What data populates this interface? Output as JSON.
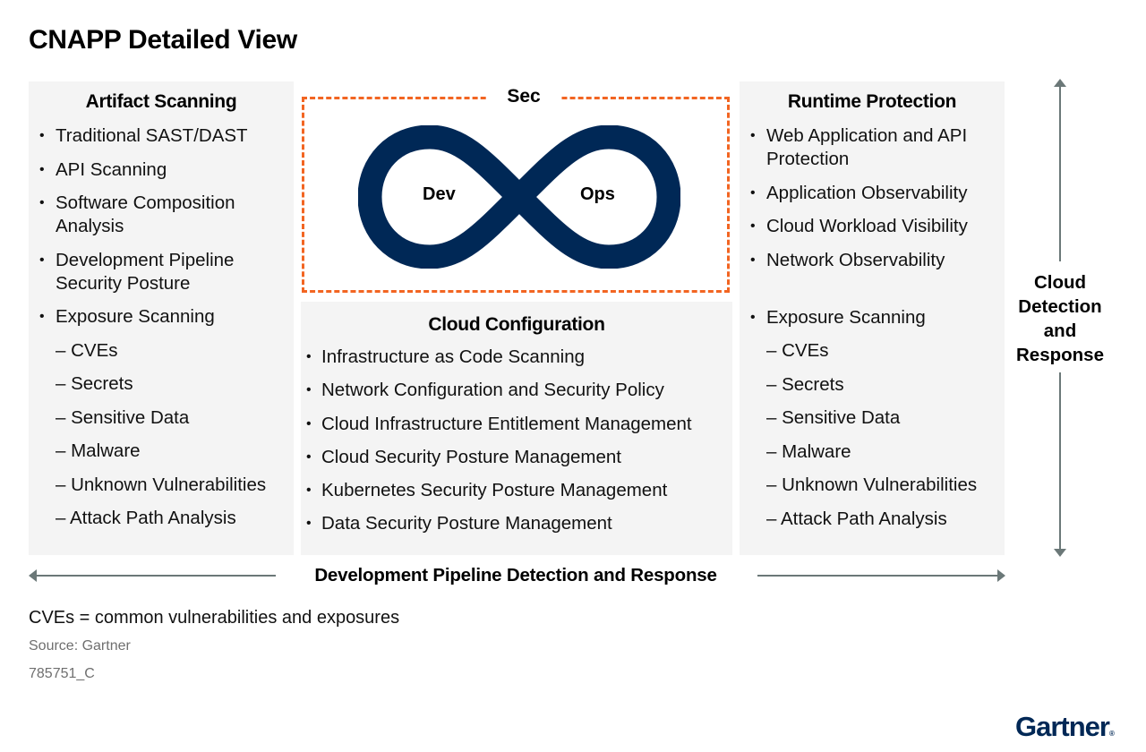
{
  "title": "CNAPP Detailed View",
  "colors": {
    "panel_bg": "#f4f4f4",
    "devops_loop": "#002856",
    "sec_border": "#f26522",
    "arrow": "#6b7878",
    "logo": "#002856",
    "source_text": "#6f6f6f"
  },
  "artifact_scanning": {
    "heading": "Artifact Scanning",
    "items": [
      {
        "type": "bullet",
        "text": "Traditional SAST/DAST"
      },
      {
        "type": "bullet",
        "text": "API Scanning"
      },
      {
        "type": "bullet",
        "text": "Software Composition Analysis"
      },
      {
        "type": "bullet",
        "text": "Development Pipeline Security Posture"
      },
      {
        "type": "bullet",
        "text": "Exposure Scanning"
      },
      {
        "type": "sub",
        "text": "– CVEs"
      },
      {
        "type": "sub",
        "text": "– Secrets"
      },
      {
        "type": "sub",
        "text": "– Sensitive Data"
      },
      {
        "type": "sub",
        "text": "– Malware"
      },
      {
        "type": "sub",
        "text": "– Unknown Vulnerabilities"
      },
      {
        "type": "sub",
        "text": "– Attack Path Analysis"
      }
    ]
  },
  "devsecops": {
    "sec_label": "Sec",
    "dev_label": "Dev",
    "ops_label": "Ops"
  },
  "cloud_configuration": {
    "heading": "Cloud Configuration",
    "items": [
      {
        "type": "bullet",
        "text": "Infrastructure as Code Scanning"
      },
      {
        "type": "bullet",
        "text": "Network Configuration and Security Policy"
      },
      {
        "type": "bullet",
        "text": "Cloud Infrastructure Entitlement Management"
      },
      {
        "type": "bullet",
        "text": "Cloud Security Posture Management"
      },
      {
        "type": "bullet",
        "text": "Kubernetes Security Posture Management"
      },
      {
        "type": "bullet",
        "text": "Data Security Posture Management"
      }
    ]
  },
  "runtime_protection": {
    "heading": "Runtime Protection",
    "items": [
      {
        "type": "bullet",
        "text": "Web Application and API Protection"
      },
      {
        "type": "bullet",
        "text": "Application Observability"
      },
      {
        "type": "bullet",
        "text": "Cloud Workload Visibility"
      },
      {
        "type": "bullet",
        "text": "Network Observability"
      },
      {
        "type": "bullet gap",
        "text": "Exposure Scanning"
      },
      {
        "type": "sub",
        "text": "– CVEs"
      },
      {
        "type": "sub",
        "text": "– Secrets"
      },
      {
        "type": "sub",
        "text": "– Sensitive Data"
      },
      {
        "type": "sub",
        "text": "– Malware"
      },
      {
        "type": "sub",
        "text": "– Unknown Vulnerabilities"
      },
      {
        "type": "sub",
        "text": "– Attack Path Analysis"
      }
    ]
  },
  "vertical_axis_label": "Cloud Detection and Response",
  "horizontal_axis_label": "Development Pipeline Detection and Response",
  "footnote": "CVEs = common vulnerabilities and exposures",
  "source": "Source: Gartner",
  "figure_id": "785751_C",
  "logo_text": "Gartner",
  "logo_mark": "®"
}
